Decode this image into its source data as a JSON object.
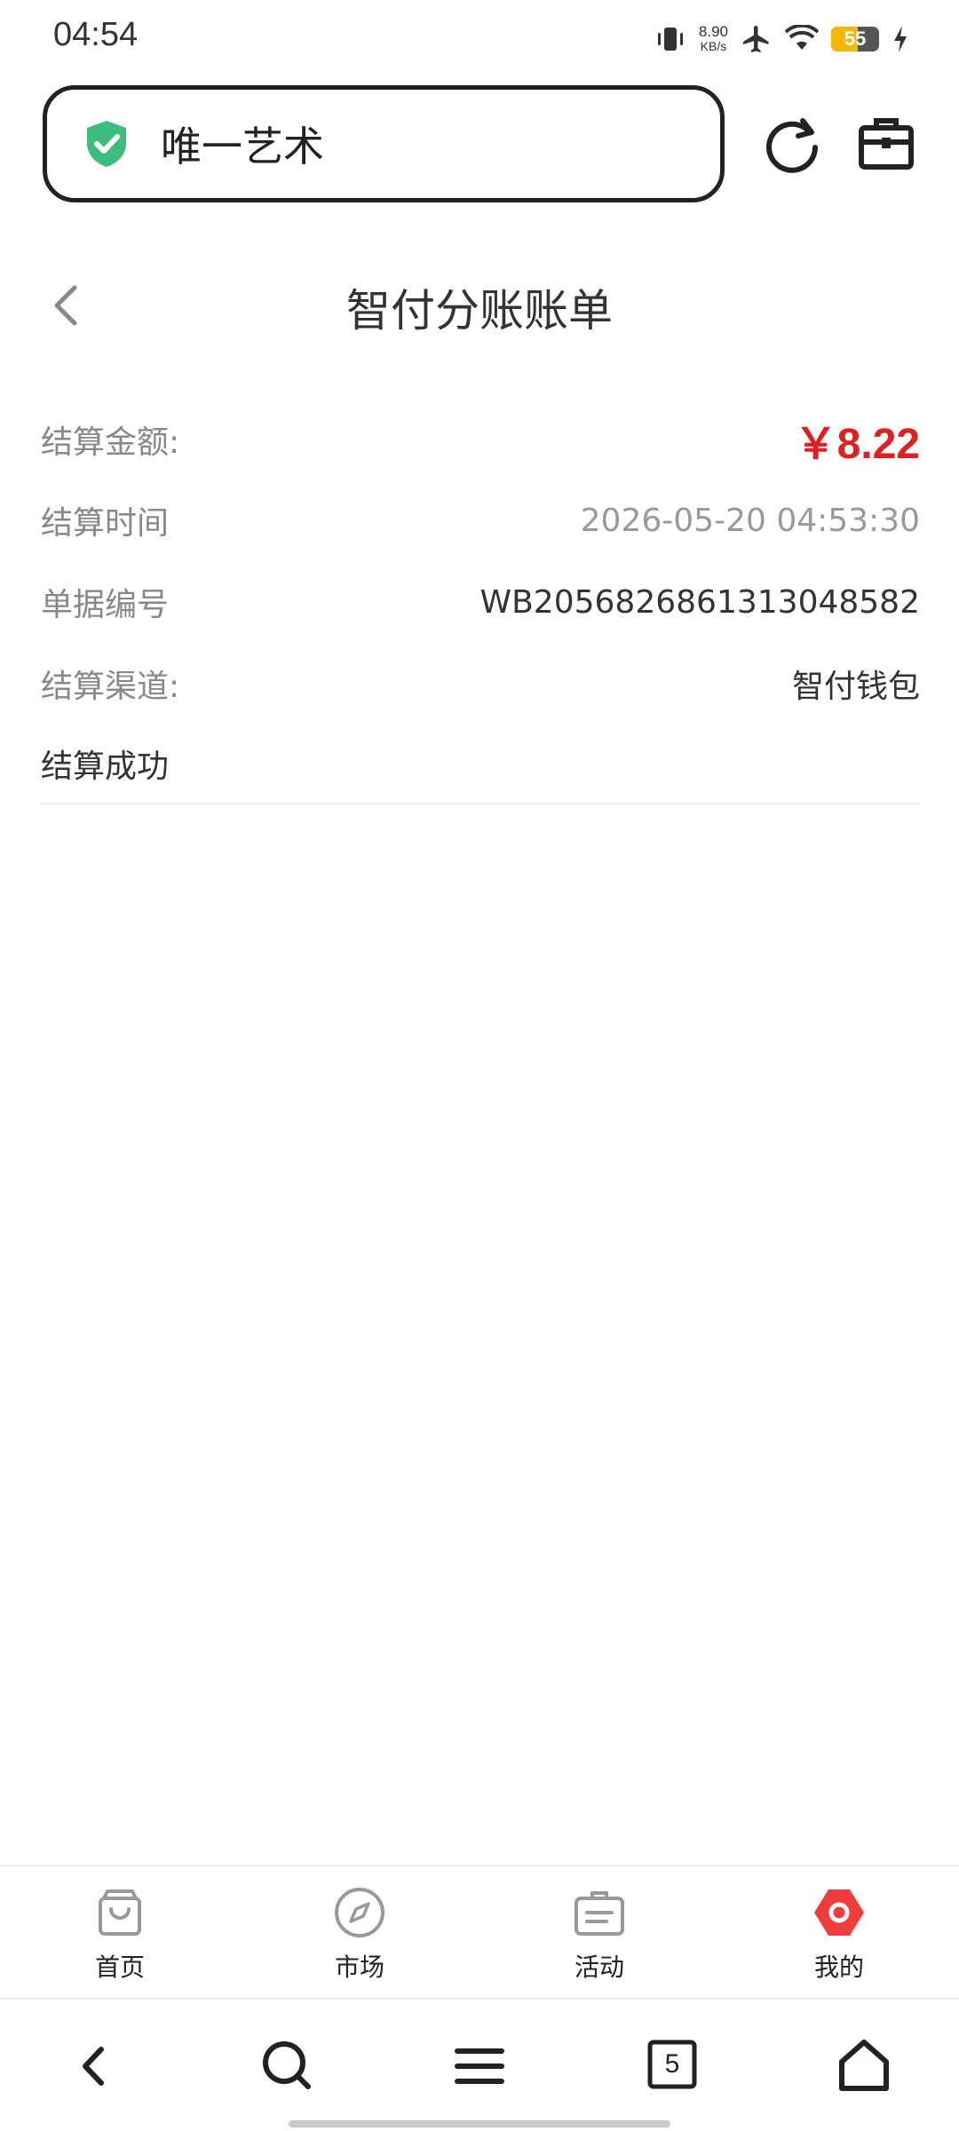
{
  "status_bar": {
    "time": "04:54",
    "net_speed_value": "8.90",
    "net_speed_unit": "KB/s",
    "battery_level": "55",
    "battery_fraction": 0.55,
    "icons": [
      "vibrate-icon",
      "airplane-icon",
      "wifi-icon",
      "battery-icon",
      "charging-icon"
    ]
  },
  "browser": {
    "address_text": "唯一艺术",
    "shield_color": "#3dbd7d"
  },
  "header": {
    "title": "智付分账账单"
  },
  "details": {
    "amount_label": "结算金额:",
    "amount_value": "￥8.22",
    "time_label": "结算时间",
    "time_value": "2026-05-20 04:53:30",
    "order_label": "单据编号",
    "order_value": "WB2056826861313048582",
    "channel_label": "结算渠道:",
    "channel_value": "智付钱包",
    "status_text": "结算成功",
    "amount_color": "#e02020"
  },
  "tab_bar": {
    "items": [
      {
        "label": "首页",
        "icon": "shopping-bag-icon"
      },
      {
        "label": "市场",
        "icon": "compass-icon"
      },
      {
        "label": "活动",
        "icon": "briefcase-icon"
      },
      {
        "label": "我的",
        "icon": "profile-hexagon-icon"
      }
    ],
    "active_color": "#f03c3c"
  },
  "nav_bar": {
    "tabs_count": "5",
    "icons": [
      "back-icon",
      "search-icon",
      "menu-icon",
      "tabs-icon",
      "home-icon"
    ]
  }
}
